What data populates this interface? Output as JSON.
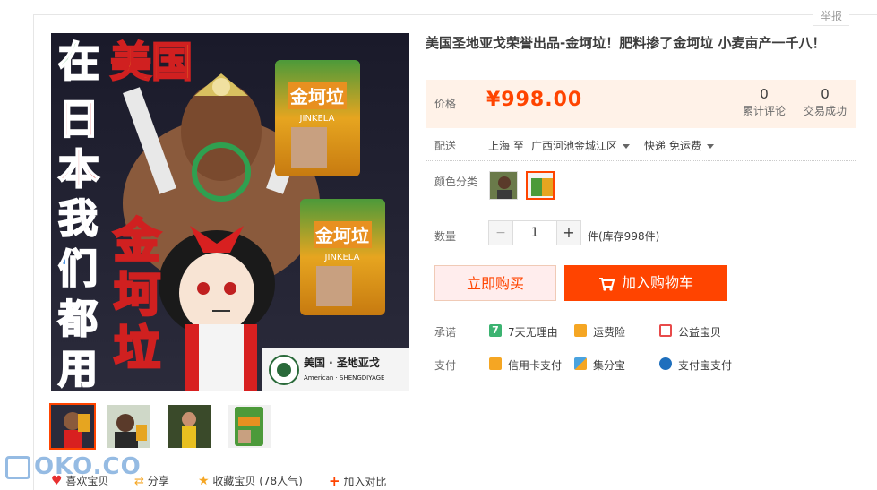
{
  "report_label": "举报",
  "product": {
    "title": "美国圣地亚戈荣誉出品-金坷垃！肥料掺了金坷垃 小麦亩产一千八！",
    "image": {
      "poster_left_chars": [
        "在",
        "日",
        "本",
        "我",
        "们",
        "都",
        "用"
      ],
      "poster_top_red": "美国",
      "poster_brand_big": "金坷垃",
      "bag_cn": "金坷垃",
      "bag_en": "JINKELA",
      "logo_cn": "美国 · 圣地亚戈",
      "logo_en": "American · SHENGDIYAGE"
    }
  },
  "price": {
    "label": "价格",
    "value": "¥998.00"
  },
  "stats": [
    {
      "number": "0",
      "label": "累计评论"
    },
    {
      "number": "0",
      "label": "交易成功"
    }
  ],
  "shipping": {
    "label": "配送",
    "from": "上海",
    "to_word": "至",
    "destination": "广西河池金城江区",
    "method": "快递 免运费"
  },
  "color": {
    "label": "颜色分类"
  },
  "quantity": {
    "label": "数量",
    "minus": "−",
    "value": "1",
    "plus": "+",
    "stock": "件(库存998件)"
  },
  "buttons": {
    "buy_now": "立即购买",
    "add_cart": "加入购物车"
  },
  "promise": {
    "label": "承诺",
    "items": [
      {
        "icon": "7",
        "text": "7天无理由",
        "color": "#3cb371"
      },
      {
        "icon": "",
        "text": "运费险",
        "color": "#f5a623"
      },
      {
        "icon": "",
        "text": "公益宝贝",
        "color": "#e84a4a"
      }
    ]
  },
  "payment": {
    "label": "支付",
    "items": [
      {
        "text": "信用卡支付",
        "color": "#f5a623"
      },
      {
        "text": "集分宝",
        "color": "#4aa3df"
      },
      {
        "text": "支付宝支付",
        "color": "#1e6fbd"
      }
    ]
  },
  "bottom": {
    "like": "喜欢宝贝",
    "share": "分享",
    "collect": "收藏宝贝",
    "collect_count": "(78人气)",
    "compare": "加入对比"
  },
  "watermark": "OKO.CO",
  "colors": {
    "accent": "#ff4400",
    "price_bg": "#fff2e8"
  }
}
